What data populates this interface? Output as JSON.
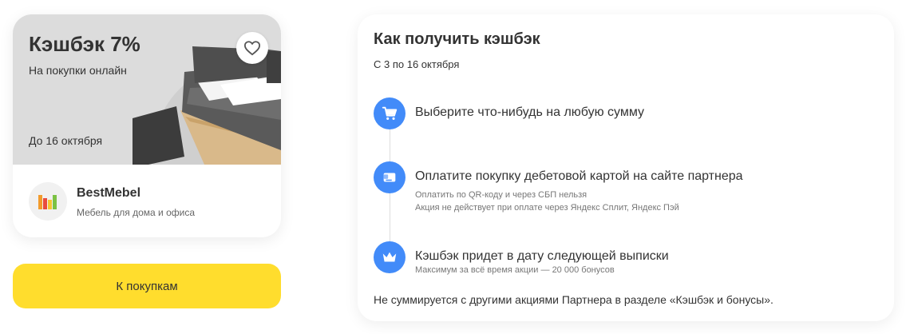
{
  "offer": {
    "title": "Кэшбэк 7%",
    "subtitle": "На покупки онлайн",
    "until": "До 16 октября",
    "favorite_icon": "heart-icon",
    "partner": {
      "name": "BestMebel",
      "description": "Мебель для дома и офиса",
      "logo_icon": "bestmebel-logo"
    }
  },
  "actions": {
    "shop_label": "К покупкам"
  },
  "howto": {
    "title": "Как получить кэшбэк",
    "period": "С 3 по 16 октября",
    "steps": [
      {
        "icon": "cart-icon",
        "title": "Выберите что-нибудь на любую сумму",
        "notes": []
      },
      {
        "icon": "card-icon",
        "title": "Оплатите покупку дебетовой картой на сайте партнера",
        "notes": [
          "Оплатить по QR-коду и через СБП нельзя",
          "Акция не действует при оплате через Яндекс Сплит, Яндекс Пэй"
        ]
      },
      {
        "icon": "crown-icon",
        "title": "Кэшбэк придет в дату следующей выписки",
        "notes": [
          "Максимум за всё время акции — 20 000 бонусов"
        ]
      }
    ],
    "footnote": "Не суммируется с другими акциями Партнера в разделе «Кэшбэк и бонусы»."
  },
  "colors": {
    "accent_yellow": "#ffdd2d",
    "step_icon_blue": "#428bf9",
    "banner_gray": "#dcdcdc"
  }
}
